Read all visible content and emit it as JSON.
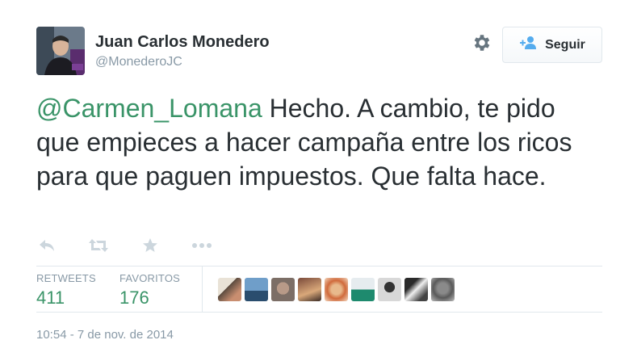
{
  "user": {
    "display_name": "Juan Carlos Monedero",
    "handle": "@MonederoJC"
  },
  "follow_button": {
    "label": "Seguir"
  },
  "tweet": {
    "mention": "@Carmen_Lomana",
    "text": " Hecho. A cambio, te pido que empieces a hacer campaña entre los ricos para que paguen impuestos. Que falta hace."
  },
  "stats": {
    "retweets_label": "RETWEETS",
    "retweets_value": "411",
    "favorites_label": "FAVORITOS",
    "favorites_value": "176"
  },
  "timestamp": "10:54 - 7 de nov. de 2014",
  "icons": [
    "gear-icon",
    "follow-person-icon",
    "reply-icon",
    "retweet-icon",
    "favorite-star-icon",
    "more-dots-icon"
  ],
  "colors": {
    "link": "#3a9468",
    "muted": "#8899a6",
    "text": "#292f33",
    "border": "#e1e8ed",
    "follow_icon": "#55acee"
  }
}
